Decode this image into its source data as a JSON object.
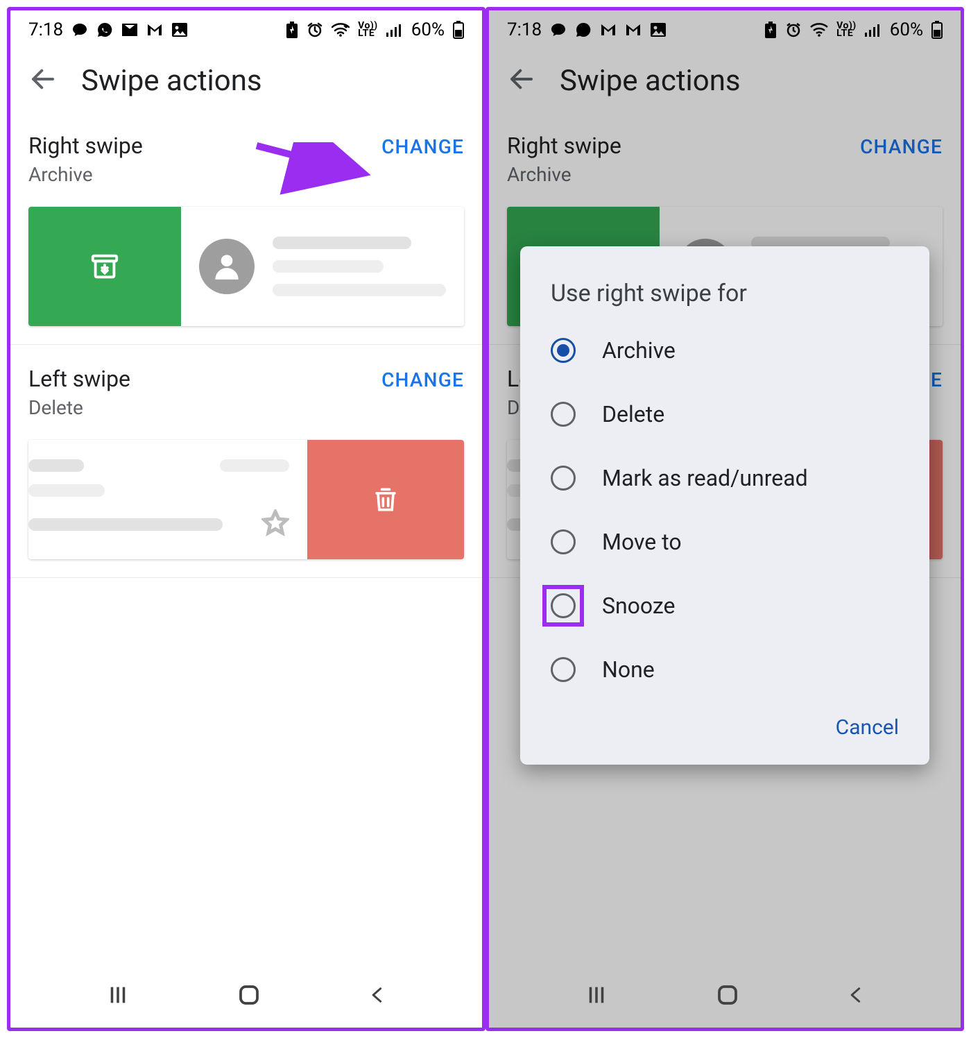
{
  "statusbar": {
    "time": "7:18",
    "battery_pct": "60%"
  },
  "appbar": {
    "title": "Swipe actions"
  },
  "right_swipe": {
    "title": "Right swipe",
    "value": "Archive",
    "change_label": "CHANGE"
  },
  "left_swipe": {
    "title": "Left swipe",
    "value": "Delete",
    "change_label": "CHANGE"
  },
  "dialog": {
    "title": "Use right swipe for",
    "options": [
      "Archive",
      "Delete",
      "Mark as read/unread",
      "Move to",
      "Snooze",
      "None"
    ],
    "selected_index": 0,
    "highlight_index": 4,
    "cancel_label": "Cancel"
  }
}
